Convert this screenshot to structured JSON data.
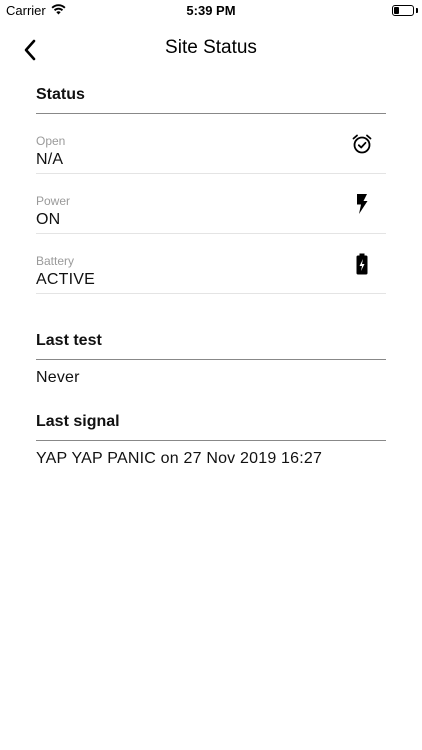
{
  "status_bar": {
    "carrier": "Carrier",
    "time": "5:39 PM",
    "battery_level": 0.3
  },
  "nav": {
    "title": "Site Status",
    "back_icon": "chevron-left-icon"
  },
  "status_section": {
    "header": "Status",
    "rows": [
      {
        "label": "Open",
        "value": "N/A",
        "icon": "alarm-clock-check-icon"
      },
      {
        "label": "Power",
        "value": "ON",
        "icon": "lightning-bolt-icon"
      },
      {
        "label": "Battery",
        "value": "ACTIVE",
        "icon": "battery-charging-icon"
      }
    ]
  },
  "last_test": {
    "header": "Last test",
    "value": "Never"
  },
  "last_signal": {
    "header": "Last signal",
    "value": "YAP YAP PANIC on 27 Nov 2019 16:27"
  }
}
